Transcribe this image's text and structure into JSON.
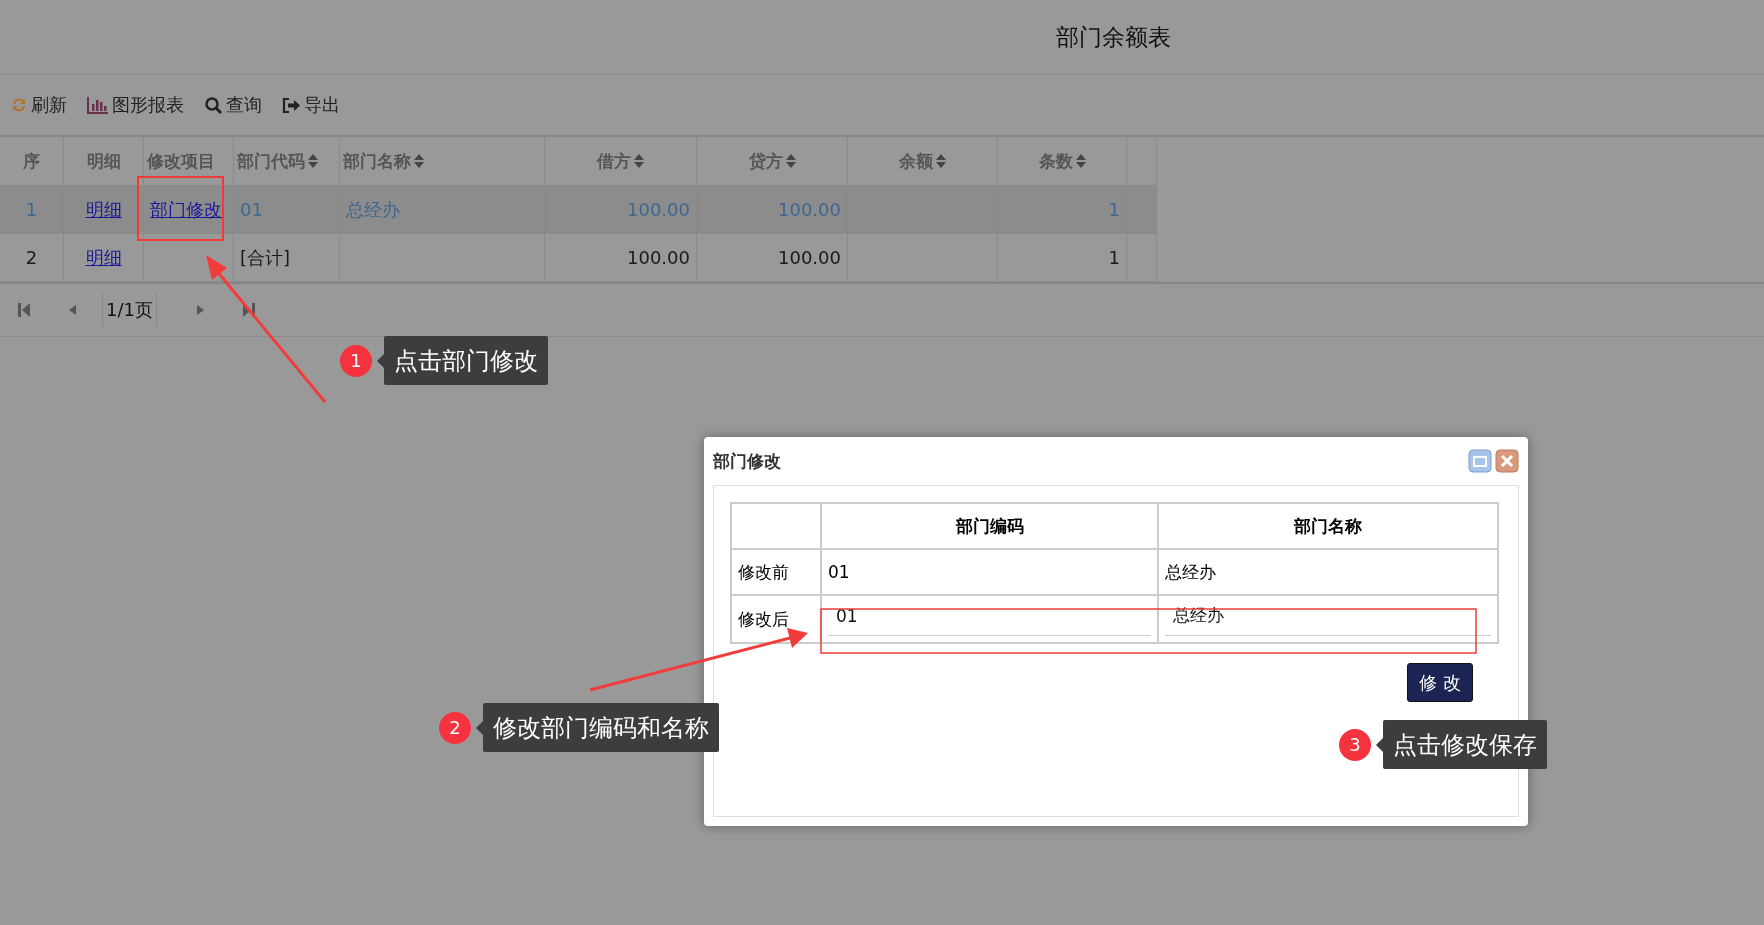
{
  "page_title": "部门余额表",
  "toolbar": [
    {
      "kind": "refresh",
      "label": "刷新"
    },
    {
      "kind": "chart",
      "label": "图形报表"
    },
    {
      "kind": "search",
      "label": "查询"
    },
    {
      "kind": "export",
      "label": "导出"
    }
  ],
  "table": {
    "columns": [
      {
        "label": "序",
        "sortable": false
      },
      {
        "label": "明细",
        "sortable": false
      },
      {
        "label": "修改项目",
        "sortable": false
      },
      {
        "label": "部门代码",
        "sortable": true
      },
      {
        "label": "部门名称",
        "sortable": true
      },
      {
        "label": "借方",
        "sortable": true
      },
      {
        "label": "贷方",
        "sortable": true
      },
      {
        "label": "余额",
        "sortable": true
      },
      {
        "label": "条数",
        "sortable": true
      }
    ],
    "rows": [
      {
        "selected": true,
        "index": "1",
        "detail_link": "明细",
        "edit_link": "部门修改",
        "code": "01",
        "name": "总经办",
        "debit": "100.00",
        "credit": "100.00",
        "count": "1"
      },
      {
        "selected": false,
        "index": "2",
        "detail_link": "明细",
        "code": "[合计]",
        "debit": "100.00",
        "credit": "100.00",
        "count": "1"
      }
    ]
  },
  "pager": {
    "page": "1/1页"
  },
  "dialog": {
    "title": "部门修改",
    "columns": [
      "部门编码",
      "部门名称"
    ],
    "before": {
      "label": "修改前",
      "code": "01",
      "name": "总经办"
    },
    "after": {
      "label": "修改后",
      "code": "01",
      "name": "总经办"
    },
    "button": "修 改"
  },
  "callouts": [
    {
      "number": "1",
      "text": "点击部门修改"
    },
    {
      "number": "2",
      "text": "修改部门编码和名称"
    },
    {
      "number": "3",
      "text": "点击修改保存"
    }
  ]
}
